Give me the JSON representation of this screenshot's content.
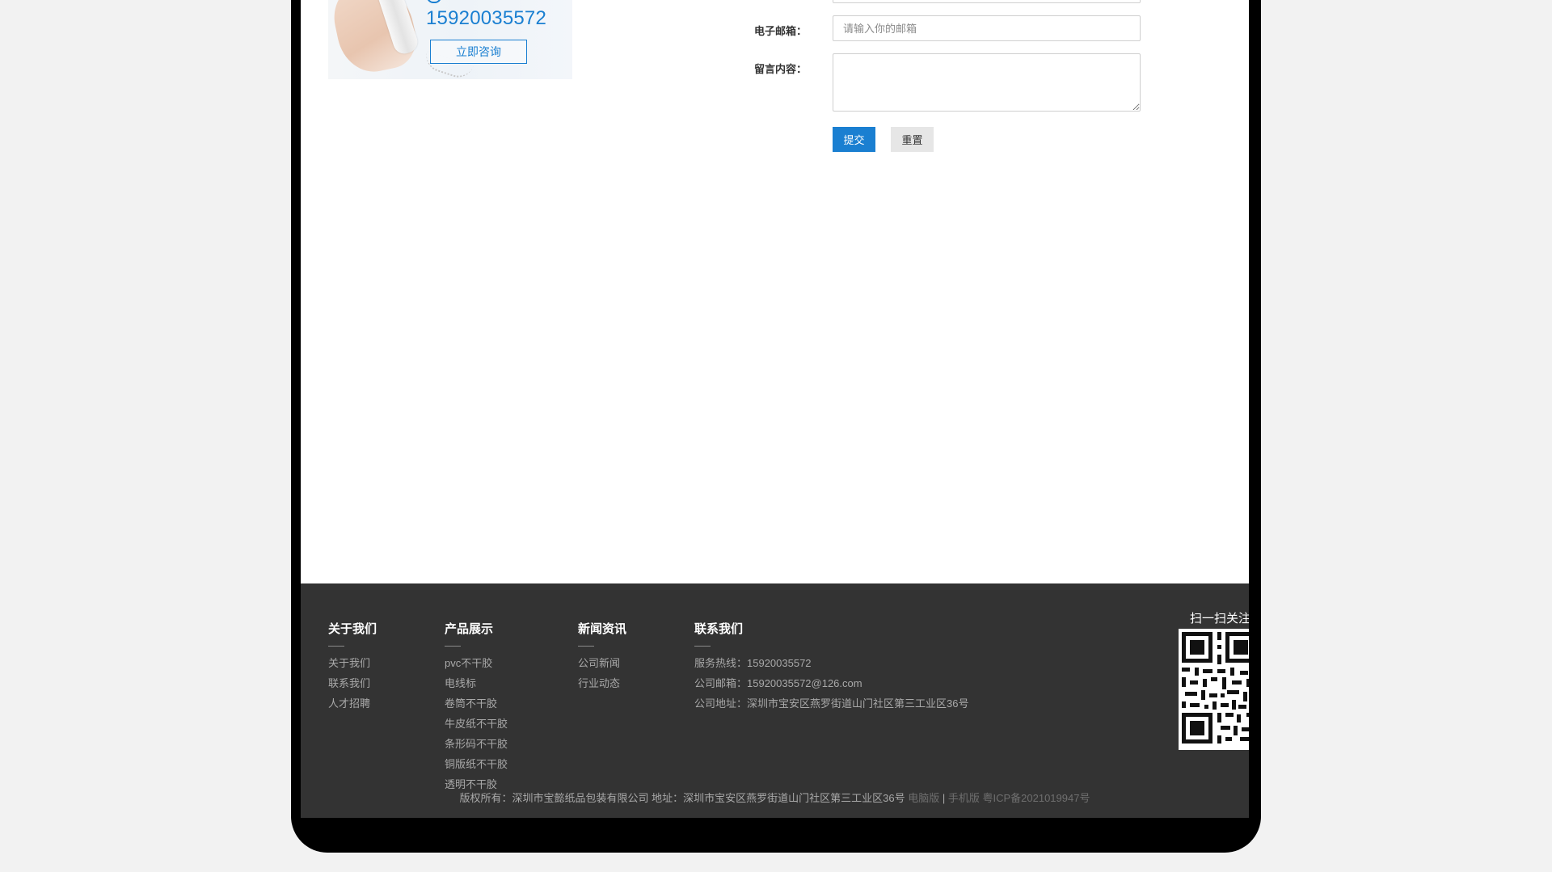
{
  "banner": {
    "phone": "15920035572",
    "consult_label": "立即咨询"
  },
  "form": {
    "email_label": "电子邮箱：",
    "email_placeholder": "请输入你的邮箱",
    "message_label": "留言内容：",
    "submit_label": "提交",
    "reset_label": "重置"
  },
  "footer": {
    "columns": [
      {
        "title": "关于我们",
        "items": [
          "关于我们",
          "联系我们",
          "人才招聘"
        ]
      },
      {
        "title": "产品展示",
        "items": [
          "pvc不干胶",
          "电线标",
          "卷筒不干胶",
          "牛皮纸不干胶",
          "条形码不干胶",
          "铜版纸不干胶",
          "透明不干胶"
        ]
      },
      {
        "title": "新闻资讯",
        "items": [
          "公司新闻",
          "行业动态"
        ]
      },
      {
        "title": "联系我们",
        "items": [
          "服务热线：15920035572",
          "公司邮箱：15920035572@126.com",
          "公司地址：深圳市宝安区燕罗街道山门社区第三工业区36号"
        ]
      }
    ],
    "qr_title": "扫一扫关注",
    "copyright": {
      "text": "版权所有：深圳市宝懿纸品包装有限公司  地址：深圳市宝安区燕罗街道山门社区第三工业区36号",
      "pc": "电脑版",
      "sep": " | ",
      "mobile": "手机版",
      "icp": "粤ICP备2021019947号"
    }
  }
}
